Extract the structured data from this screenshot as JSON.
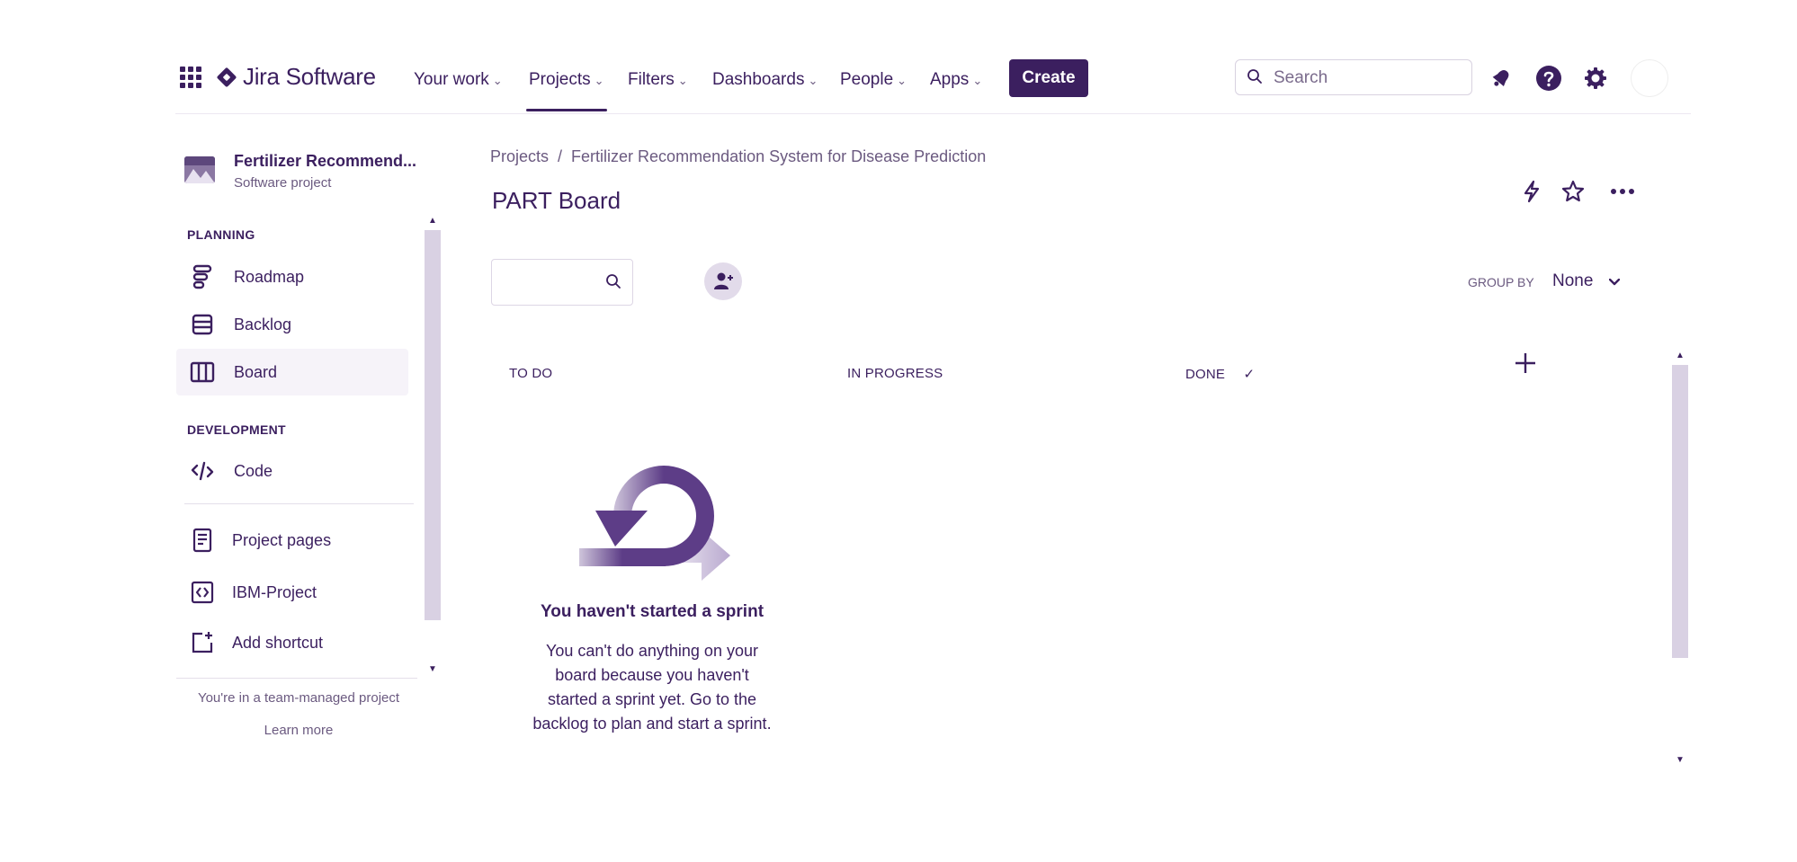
{
  "topnav": {
    "brand": "Jira Software",
    "items": [
      {
        "label": "Your work"
      },
      {
        "label": "Projects"
      },
      {
        "label": "Filters"
      },
      {
        "label": "Dashboards"
      },
      {
        "label": "People"
      },
      {
        "label": "Apps"
      }
    ],
    "chevron": "⌄",
    "create_label": "Create",
    "search_placeholder": "Search",
    "icons": [
      "app-switcher-icon",
      "notifications-icon",
      "help-icon",
      "settings-icon",
      "avatar"
    ]
  },
  "sidebar": {
    "project_name": "Fertilizer Recommend...",
    "project_type": "Software project",
    "planning_heading": "PLANNING",
    "planning_items": [
      {
        "label": "Roadmap",
        "icon": "roadmap-icon"
      },
      {
        "label": "Backlog",
        "icon": "backlog-icon"
      },
      {
        "label": "Board",
        "icon": "board-icon",
        "active": true
      }
    ],
    "development_heading": "DEVELOPMENT",
    "development_items": [
      {
        "label": "Code",
        "icon": "code-icon"
      }
    ],
    "other_items": [
      {
        "label": "Project pages",
        "icon": "pages-icon"
      },
      {
        "label": "IBM-Project",
        "icon": "link-icon"
      },
      {
        "label": "Add shortcut",
        "icon": "add-shortcut-icon"
      }
    ],
    "footer_text": "You're in a team-managed project",
    "learn_more": "Learn more"
  },
  "main": {
    "breadcrumb": [
      "Projects",
      "Fertilizer Recommendation System for Disease Prediction"
    ],
    "breadcrumb_sep": "/",
    "title": "PART Board",
    "group_by_label": "GROUP BY",
    "group_by_value": "None",
    "columns": [
      {
        "label": "TO DO"
      },
      {
        "label": "IN PROGRESS"
      },
      {
        "label": "DONE",
        "check": "✓"
      }
    ],
    "empty_title": "You haven't started a sprint",
    "empty_body": "You can't do anything on your board because you haven't started a sprint yet. Go to the backlog to plan and start a sprint."
  },
  "colors": {
    "primary": "#3b1f5f",
    "muted": "#6b5a80",
    "scroll": "#d9d1e3",
    "illustration_light": "#b9a9cf"
  }
}
